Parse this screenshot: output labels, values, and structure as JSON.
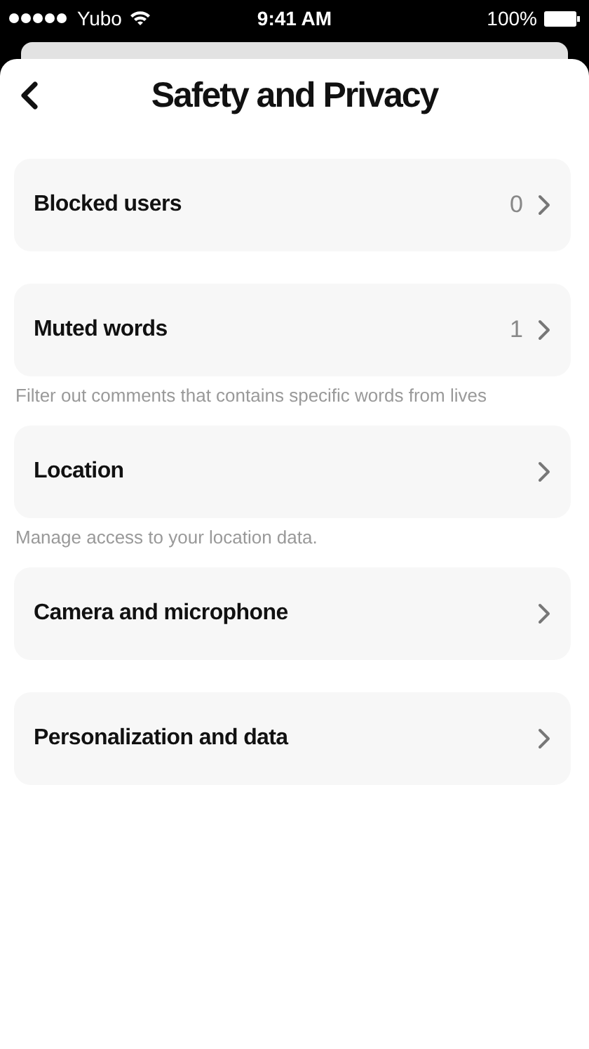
{
  "status_bar": {
    "carrier": "Yubo",
    "time": "9:41 AM",
    "battery": "100%"
  },
  "header": {
    "title": "Safety and Privacy"
  },
  "items": [
    {
      "label": "Blocked users",
      "count": "0"
    },
    {
      "label": "Muted words",
      "count": "1",
      "caption": "Filter out comments that contains specific words from lives"
    },
    {
      "label": "Location",
      "caption": "Manage access to your location data."
    },
    {
      "label": "Camera and microphone"
    },
    {
      "label": "Personalization and data"
    }
  ]
}
